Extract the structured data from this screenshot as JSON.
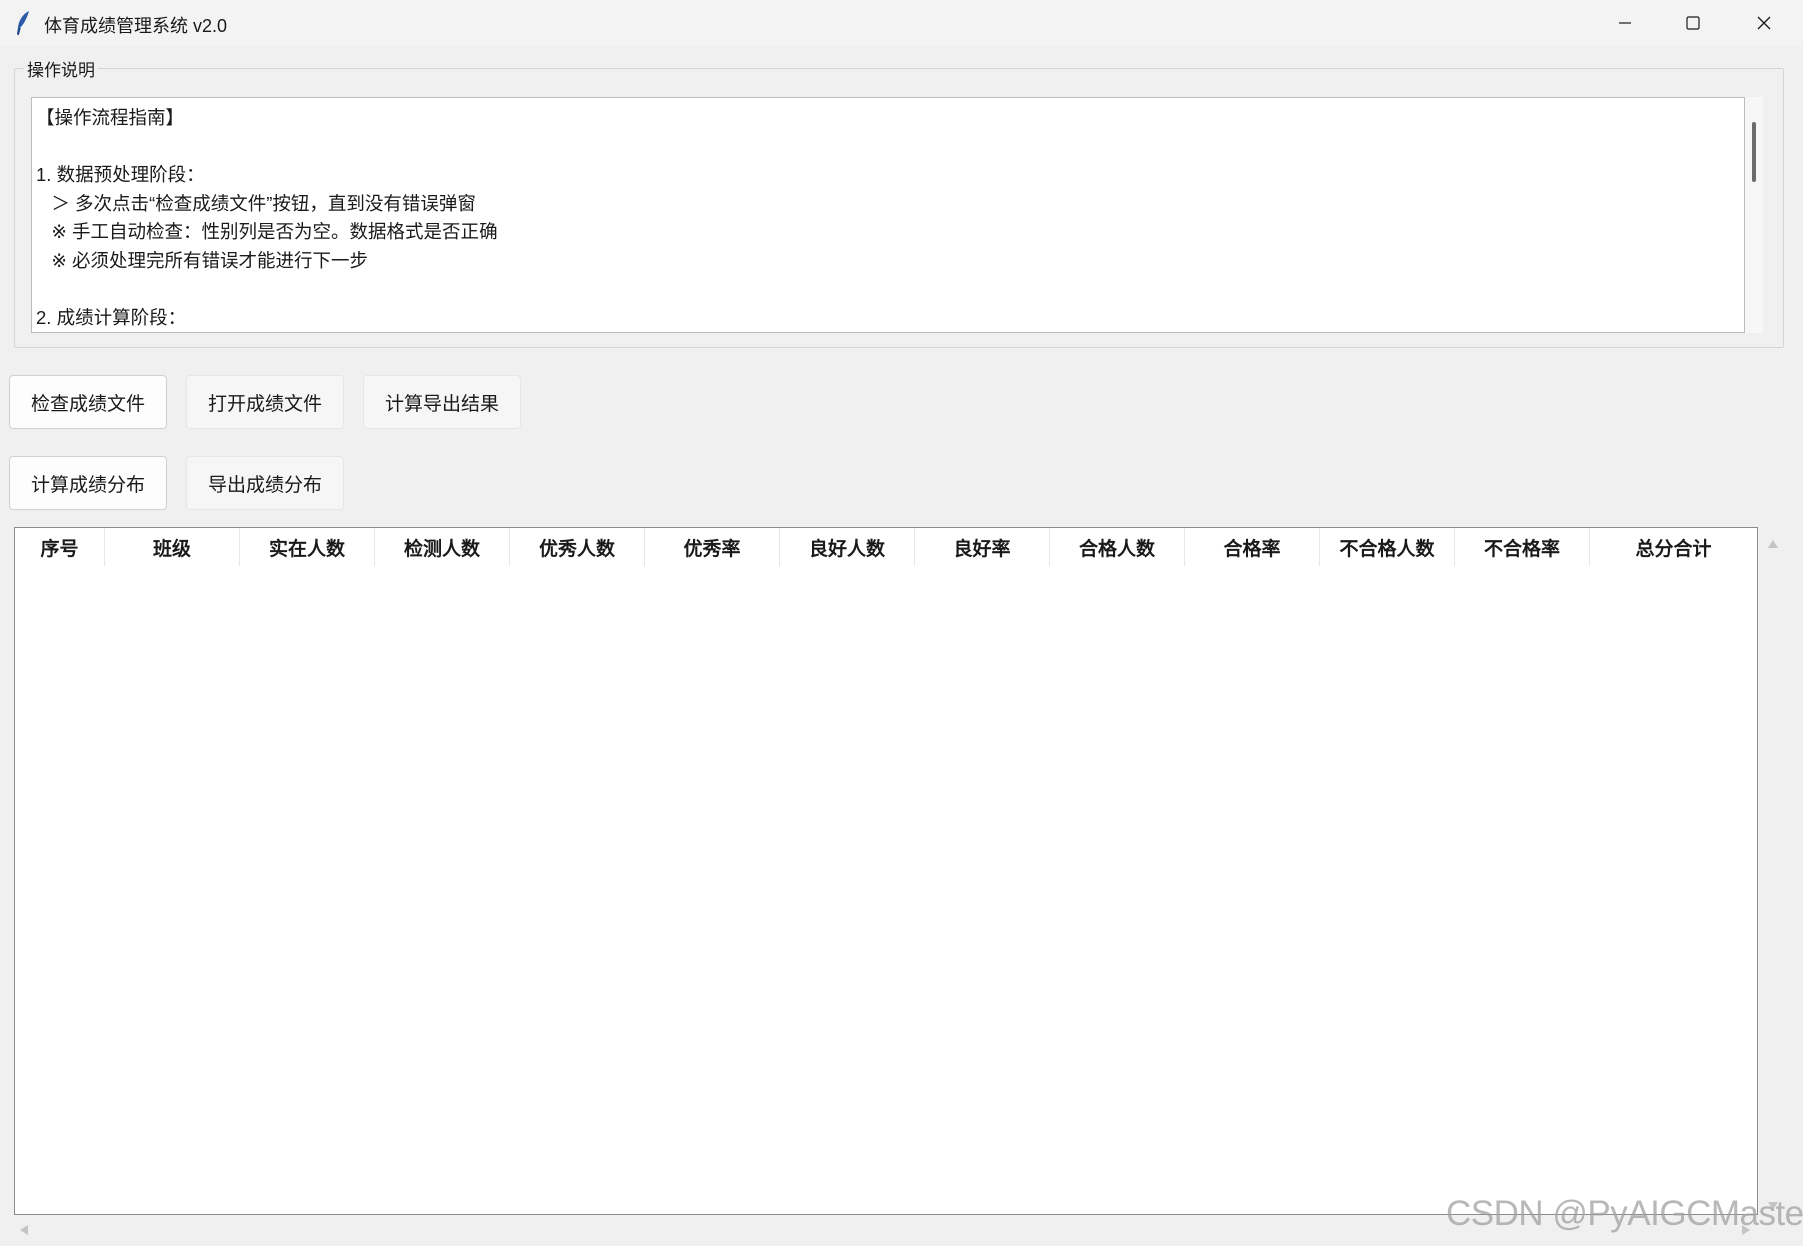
{
  "window": {
    "title": "体育成绩管理系统 v2.0"
  },
  "instructions": {
    "group_label": "操作说明",
    "lines": [
      "【操作流程指南】",
      "",
      "1. 数据预处理阶段：",
      "   ＞ 多次点击“检查成绩文件”按钮，直到没有错误弹窗",
      "   ※ 手工自动检查：性别列是否为空。数据格式是否正确",
      "   ※ 必须处理完所有错误才能进行下一步",
      "",
      "2. 成绩计算阶段："
    ]
  },
  "buttons": {
    "check_file": "检查成绩文件",
    "open_file": "打开成绩文件",
    "calc_export": "计算导出结果",
    "calc_distribution": "计算成绩分布",
    "export_distribution": "导出成绩分布"
  },
  "table": {
    "columns": [
      "序号",
      "班级",
      "实在人数",
      "检测人数",
      "优秀人数",
      "优秀率",
      "良好人数",
      "良好率",
      "合格人数",
      "合格率",
      "不合格人数",
      "不合格率",
      "总分合计"
    ],
    "rows": []
  },
  "watermark": "CSDN @PyAIGCMaster",
  "icons": {
    "app": "feather-icon",
    "minimize": "minimize-icon",
    "maximize": "maximize-icon",
    "close": "close-icon"
  }
}
